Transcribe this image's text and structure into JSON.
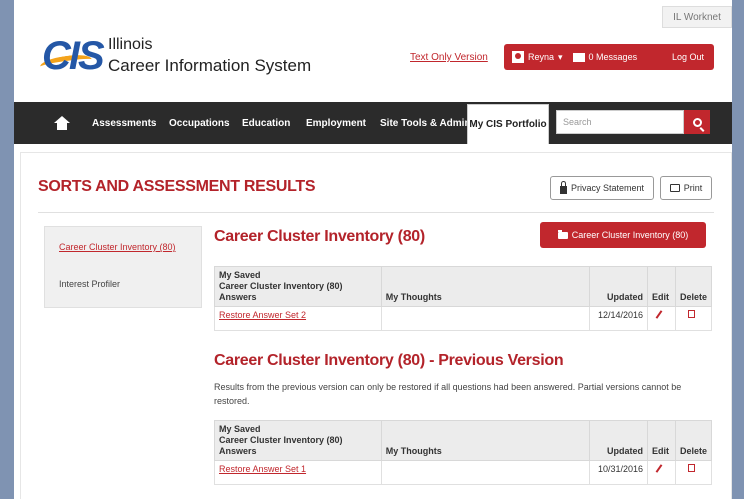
{
  "header": {
    "worknet_label": "IL Worknet",
    "logo_text": "CIS",
    "logo_line1": "Illinois",
    "logo_line2": "Career Information System",
    "text_only_link": "Text Only Version",
    "user_name": "Reyna",
    "messages_label": "0 Messages",
    "logout_label": "Log Out"
  },
  "nav": {
    "items": [
      "Assessments",
      "Occupations",
      "Education",
      "Employment",
      "Site Tools & Admin"
    ],
    "active_item": "My CIS Portfolio",
    "search_placeholder": "Search"
  },
  "page": {
    "title": "SORTS AND ASSESSMENT RESULTS",
    "privacy_button": "Privacy Statement",
    "print_button": "Print"
  },
  "sidebar": {
    "active_link": "Career Cluster Inventory (80)",
    "item": "Interest Profiler"
  },
  "section1": {
    "title": "Career Cluster Inventory (80)",
    "button": "Career Cluster Inventory (80)",
    "headers": {
      "answers": "My Saved\nCareer Cluster Inventory (80) Answers",
      "thoughts": "My Thoughts",
      "updated": "Updated",
      "edit": "Edit",
      "delete": "Delete"
    },
    "rows": [
      {
        "answer": "Restore Answer Set 2",
        "thoughts": "",
        "updated": "12/14/2016"
      }
    ]
  },
  "section2": {
    "title": "Career Cluster Inventory (80) - Previous Version",
    "description": "Results from the previous version can only be restored if all questions had been answered. Partial versions cannot be restored.",
    "headers": {
      "answers": "My Saved\nCareer Cluster Inventory (80) Answers",
      "thoughts": "My Thoughts",
      "updated": "Updated",
      "edit": "Edit",
      "delete": "Delete"
    },
    "rows": [
      {
        "answer": "Restore Answer Set 1",
        "thoughts": "",
        "updated": "10/31/2016"
      }
    ]
  },
  "colors": {
    "brand_red": "#c1272d",
    "nav_dark": "#2b2b2b",
    "logo_blue": "#2457a6",
    "logo_orange": "#f4a31b"
  }
}
